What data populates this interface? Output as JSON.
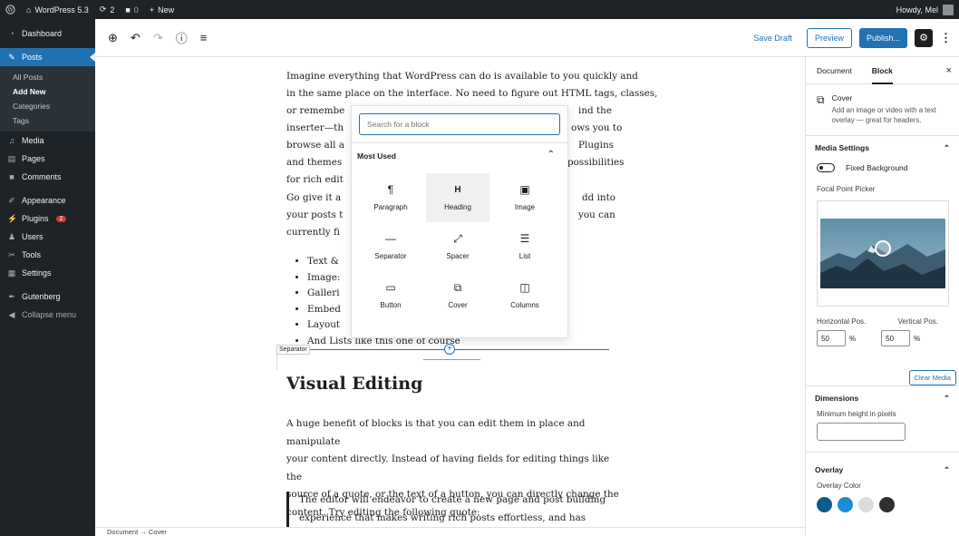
{
  "adminbar": {
    "site_name": "WordPress 5.3",
    "updates_count": "2",
    "comments_count": "0",
    "new_label": "New",
    "howdy": "Howdy, Mel"
  },
  "sidebar": {
    "dashboard": "Dashboard",
    "posts": "Posts",
    "posts_sub": [
      "All Posts",
      "Add New",
      "Categories",
      "Tags"
    ],
    "media": "Media",
    "pages": "Pages",
    "comments": "Comments",
    "appearance": "Appearance",
    "plugins": "Plugins",
    "plugins_badge": "2",
    "users": "Users",
    "tools": "Tools",
    "settings": "Settings",
    "gutenberg": "Gutenberg",
    "collapse": "Collapse menu"
  },
  "toolbar": {
    "save_draft": "Save Draft",
    "preview": "Preview",
    "publish": "Publish..."
  },
  "content": {
    "p1_lines": [
      "Imagine everything that WordPress can do is available to you quickly and",
      "in the same place on the interface. No need to figure out HTML tags, classes,",
      "or remembe",
      "ind the",
      "inserter—th",
      "ows you to",
      "browse all a",
      "Plugins",
      "and themes",
      "possibilities",
      "for rich edit"
    ],
    "p2_lines": [
      "Go give it a",
      "dd into",
      "your posts t",
      "you can",
      "currently fi"
    ],
    "list_items": [
      "Text &",
      "Image:",
      "Galleri",
      "Embed",
      "Layout",
      "And Lists like this one of course"
    ],
    "separator_label": "Separator",
    "heading": "Visual Editing",
    "p3_lines": [
      "A huge benefit of blocks is that you can edit them in place and manipulate",
      "your content directly. Instead of having fields for editing things like the",
      "source of a quote, or the text of a button, you can directly change the",
      "content. Try editing the following quote:"
    ],
    "quote_lines": [
      "The editor will endeavor to create a new page and post building",
      "experience that makes writing rich posts effortless, and has “blocks” to"
    ]
  },
  "inserter": {
    "search_placeholder": "Search for a block",
    "section": "Most Used",
    "blocks": [
      {
        "label": "Paragraph",
        "icon": "¶"
      },
      {
        "label": "Heading",
        "icon": "H"
      },
      {
        "label": "Image",
        "icon": "▣"
      },
      {
        "label": "Separator",
        "icon": "—"
      },
      {
        "label": "Spacer",
        "icon": "⤢"
      },
      {
        "label": "List",
        "icon": "☰"
      },
      {
        "label": "Button",
        "icon": "▭"
      },
      {
        "label": "Cover",
        "icon": "⧉"
      },
      {
        "label": "Columns",
        "icon": "◫"
      }
    ]
  },
  "panel": {
    "tab_document": "Document",
    "tab_block": "Block",
    "block_title": "Cover",
    "block_desc": "Add an image or video with a text overlay — great for headers.",
    "media_settings": "Media Settings",
    "fixed_background": "Fixed Background",
    "focal_point": "Focal Point Picker",
    "horizontal_label": "Horizontal Pos.",
    "vertical_label": "Vertical Pos.",
    "horizontal_value": "50",
    "vertical_value": "50",
    "unit": "%",
    "clear_media": "Clear Media",
    "dimensions": "Dimensions",
    "min_height_label": "Minimum height in pixels",
    "min_height_value": "",
    "overlay": "Overlay",
    "overlay_color": "Overlay Color",
    "swatch_colors": [
      "#0e5a8a",
      "#1e8cd3",
      "#dcdcdc",
      "#2f2f2f"
    ]
  },
  "statusbar": {
    "crumb": "Document → Cover"
  }
}
